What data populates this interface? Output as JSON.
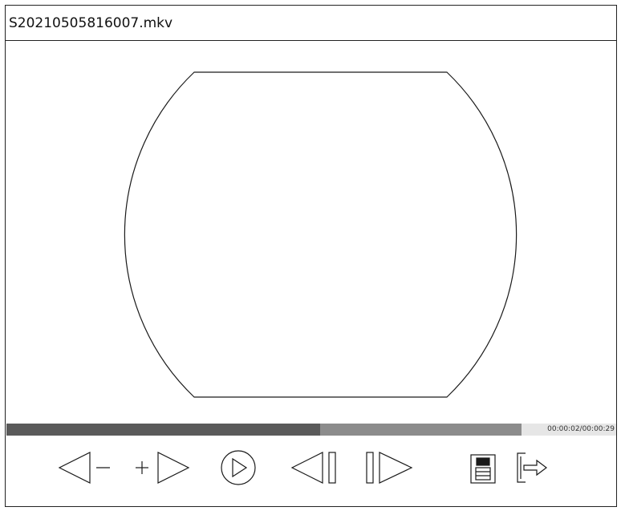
{
  "window": {
    "title": "S20210505816007.mkv"
  },
  "player": {
    "progress": {
      "played_fraction": 0.515,
      "buffered_fraction": 0.845,
      "time_label": "00:00:02/00:00:29"
    },
    "controls": [
      {
        "name": "slow-down-button",
        "icon": "rewind-minus-icon"
      },
      {
        "name": "speed-up-button",
        "icon": "plus-forward-icon"
      },
      {
        "name": "play-button",
        "icon": "play-circle-icon"
      },
      {
        "name": "previous-frame-button",
        "icon": "step-back-icon"
      },
      {
        "name": "next-frame-button",
        "icon": "step-forward-icon"
      },
      {
        "name": "save-button",
        "icon": "floppy-disk-icon"
      },
      {
        "name": "exit-button",
        "icon": "exit-arrow-icon"
      }
    ]
  },
  "colors": {
    "played": "#5a5a5a",
    "buffered": "#8c8c8c",
    "track": "#e6e6e6",
    "stroke": "#1a1a1a"
  }
}
